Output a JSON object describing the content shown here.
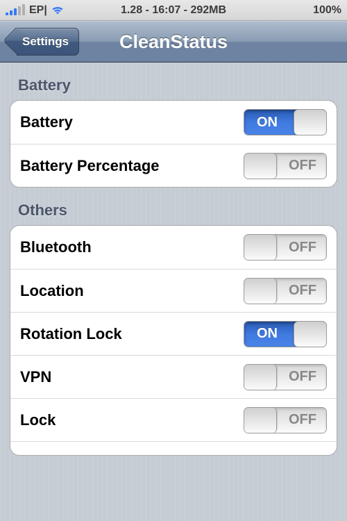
{
  "status_bar": {
    "carrier": "EP|",
    "center_text": "1.28 - 16:07 - 292MB",
    "battery_pct": "100%"
  },
  "nav": {
    "back_label": "Settings",
    "title": "CleanStatus"
  },
  "switch_labels": {
    "on": "ON",
    "off": "OFF"
  },
  "sections": {
    "battery": {
      "header": "Battery",
      "rows": [
        {
          "label": "Battery",
          "state": "on"
        },
        {
          "label": "Battery Percentage",
          "state": "off"
        }
      ]
    },
    "others": {
      "header": "Others",
      "rows": [
        {
          "label": "Bluetooth",
          "state": "off"
        },
        {
          "label": "Location",
          "state": "off"
        },
        {
          "label": "Rotation Lock",
          "state": "on"
        },
        {
          "label": "VPN",
          "state": "off"
        },
        {
          "label": "Lock",
          "state": "off"
        }
      ]
    }
  }
}
